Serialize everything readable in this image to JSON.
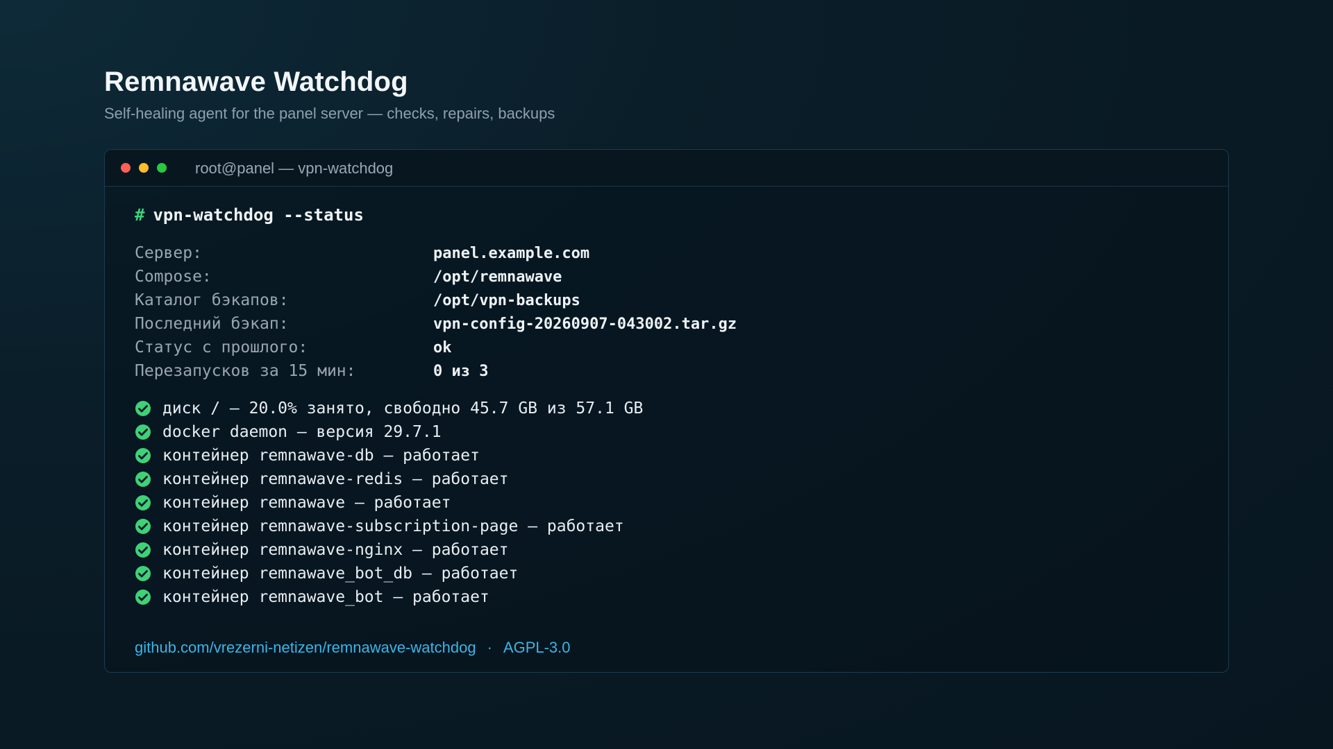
{
  "header": {
    "title": "Remnawave Watchdog",
    "subtitle": "Self-healing agent for the panel server — checks, repairs, backups"
  },
  "window": {
    "title": "root@panel — vpn-watchdog",
    "controls": [
      "close",
      "minimize",
      "maximize"
    ]
  },
  "terminal": {
    "prompt": "#",
    "command": "vpn-watchdog --status",
    "info": [
      {
        "key": "Сервер:",
        "value": "panel.example.com"
      },
      {
        "key": "Compose:",
        "value": "/opt/remnawave"
      },
      {
        "key": "Каталог бэкапов:",
        "value": "/opt/vpn-backups"
      },
      {
        "key": "Последний бэкап:",
        "value": "vpn-config-20260907-043002.tar.gz"
      },
      {
        "key": "Статус с прошлого:",
        "value": "ok"
      },
      {
        "key": "Перезапусков за 15 мин:",
        "value": "0 из 3"
      }
    ],
    "checks": [
      "диск / — 20.0% занято, свободно 45.7 GB из 57.1 GB",
      "docker daemon — версия 29.7.1",
      "контейнер remnawave-db — работает",
      "контейнер remnawave-redis — работает",
      "контейнер remnawave — работает",
      "контейнер remnawave-subscription-page — работает",
      "контейнер remnawave-nginx — работает",
      "контейнер remnawave_bot_db — работает",
      "контейнер remnawave_bot — работает"
    ]
  },
  "footer": {
    "repo_link": "github.com/vrezerni-netizen/remnawave-watchdog",
    "separator": "·",
    "license": "AGPL-3.0"
  },
  "colors": {
    "background": "#0a1d28",
    "accent_green": "#3fd178",
    "link": "#39b6e8",
    "dot_red": "#ff5f57",
    "dot_yellow": "#febc2e",
    "dot_green": "#28c840"
  },
  "icons": {
    "check": "check-circle-icon"
  }
}
